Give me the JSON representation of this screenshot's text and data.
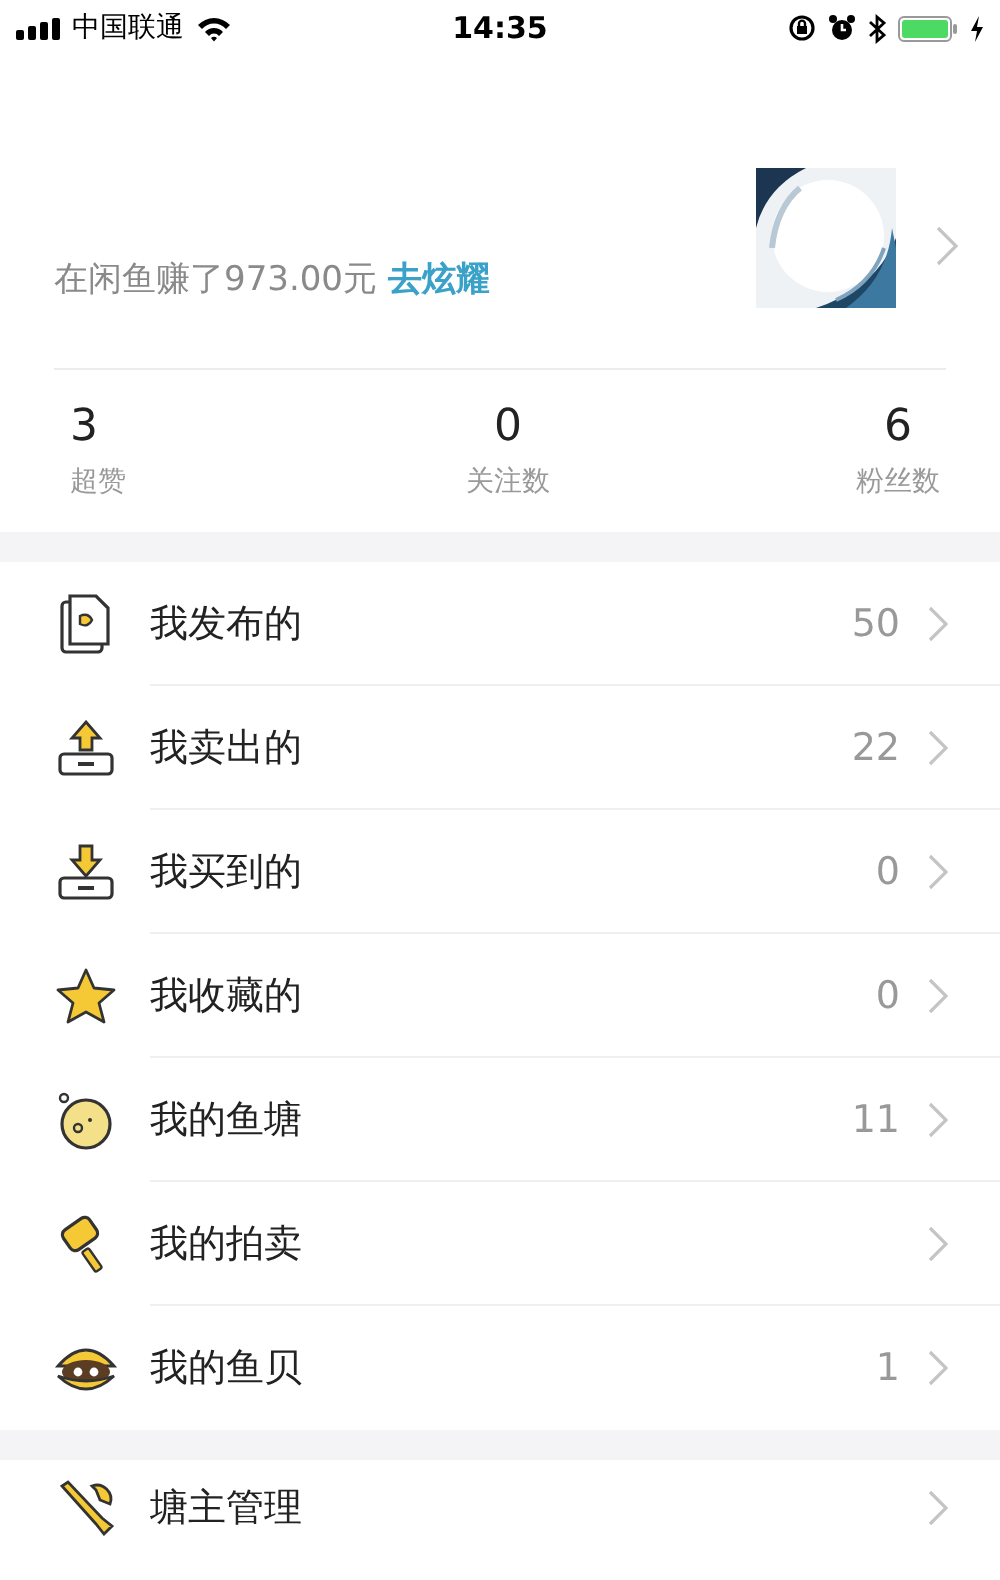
{
  "status_bar": {
    "carrier": "中国联通",
    "time": "14:35"
  },
  "profile": {
    "earnings_text": "在闲鱼赚了973.00元",
    "share_link": "去炫耀"
  },
  "stats": [
    {
      "value": "3",
      "label": "超赞"
    },
    {
      "value": "0",
      "label": "关注数"
    },
    {
      "value": "6",
      "label": "粉丝数"
    }
  ],
  "menu": [
    {
      "label": "我发布的",
      "count": "50"
    },
    {
      "label": "我卖出的",
      "count": "22"
    },
    {
      "label": "我买到的",
      "count": "0"
    },
    {
      "label": "我收藏的",
      "count": "0"
    },
    {
      "label": "我的鱼塘",
      "count": "11"
    },
    {
      "label": "我的拍卖"
    },
    {
      "label": "我的鱼贝",
      "count": "1"
    }
  ],
  "menu_2": [
    {
      "label": "塘主管理"
    }
  ]
}
